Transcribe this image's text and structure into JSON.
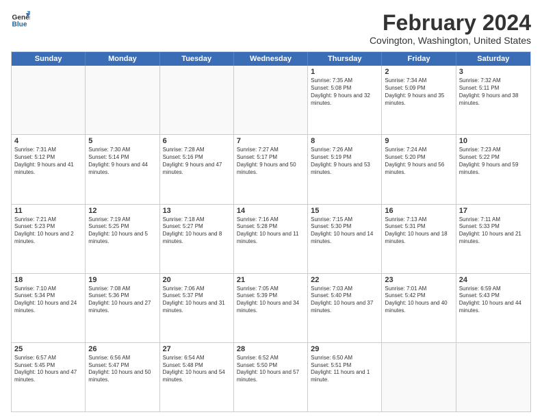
{
  "logo": {
    "line1": "General",
    "line2": "Blue"
  },
  "title": "February 2024",
  "subtitle": "Covington, Washington, United States",
  "days": [
    "Sunday",
    "Monday",
    "Tuesday",
    "Wednesday",
    "Thursday",
    "Friday",
    "Saturday"
  ],
  "weeks": [
    [
      {
        "day": "",
        "empty": true
      },
      {
        "day": "",
        "empty": true
      },
      {
        "day": "",
        "empty": true
      },
      {
        "day": "",
        "empty": true
      },
      {
        "day": "1",
        "sunrise": "Sunrise: 7:35 AM",
        "sunset": "Sunset: 5:08 PM",
        "daylight": "Daylight: 9 hours and 32 minutes."
      },
      {
        "day": "2",
        "sunrise": "Sunrise: 7:34 AM",
        "sunset": "Sunset: 5:09 PM",
        "daylight": "Daylight: 9 hours and 35 minutes."
      },
      {
        "day": "3",
        "sunrise": "Sunrise: 7:32 AM",
        "sunset": "Sunset: 5:11 PM",
        "daylight": "Daylight: 9 hours and 38 minutes."
      }
    ],
    [
      {
        "day": "4",
        "sunrise": "Sunrise: 7:31 AM",
        "sunset": "Sunset: 5:12 PM",
        "daylight": "Daylight: 9 hours and 41 minutes."
      },
      {
        "day": "5",
        "sunrise": "Sunrise: 7:30 AM",
        "sunset": "Sunset: 5:14 PM",
        "daylight": "Daylight: 9 hours and 44 minutes."
      },
      {
        "day": "6",
        "sunrise": "Sunrise: 7:28 AM",
        "sunset": "Sunset: 5:16 PM",
        "daylight": "Daylight: 9 hours and 47 minutes."
      },
      {
        "day": "7",
        "sunrise": "Sunrise: 7:27 AM",
        "sunset": "Sunset: 5:17 PM",
        "daylight": "Daylight: 9 hours and 50 minutes."
      },
      {
        "day": "8",
        "sunrise": "Sunrise: 7:26 AM",
        "sunset": "Sunset: 5:19 PM",
        "daylight": "Daylight: 9 hours and 53 minutes."
      },
      {
        "day": "9",
        "sunrise": "Sunrise: 7:24 AM",
        "sunset": "Sunset: 5:20 PM",
        "daylight": "Daylight: 9 hours and 56 minutes."
      },
      {
        "day": "10",
        "sunrise": "Sunrise: 7:23 AM",
        "sunset": "Sunset: 5:22 PM",
        "daylight": "Daylight: 9 hours and 59 minutes."
      }
    ],
    [
      {
        "day": "11",
        "sunrise": "Sunrise: 7:21 AM",
        "sunset": "Sunset: 5:23 PM",
        "daylight": "Daylight: 10 hours and 2 minutes."
      },
      {
        "day": "12",
        "sunrise": "Sunrise: 7:19 AM",
        "sunset": "Sunset: 5:25 PM",
        "daylight": "Daylight: 10 hours and 5 minutes."
      },
      {
        "day": "13",
        "sunrise": "Sunrise: 7:18 AM",
        "sunset": "Sunset: 5:27 PM",
        "daylight": "Daylight: 10 hours and 8 minutes."
      },
      {
        "day": "14",
        "sunrise": "Sunrise: 7:16 AM",
        "sunset": "Sunset: 5:28 PM",
        "daylight": "Daylight: 10 hours and 11 minutes."
      },
      {
        "day": "15",
        "sunrise": "Sunrise: 7:15 AM",
        "sunset": "Sunset: 5:30 PM",
        "daylight": "Daylight: 10 hours and 14 minutes."
      },
      {
        "day": "16",
        "sunrise": "Sunrise: 7:13 AM",
        "sunset": "Sunset: 5:31 PM",
        "daylight": "Daylight: 10 hours and 18 minutes."
      },
      {
        "day": "17",
        "sunrise": "Sunrise: 7:11 AM",
        "sunset": "Sunset: 5:33 PM",
        "daylight": "Daylight: 10 hours and 21 minutes."
      }
    ],
    [
      {
        "day": "18",
        "sunrise": "Sunrise: 7:10 AM",
        "sunset": "Sunset: 5:34 PM",
        "daylight": "Daylight: 10 hours and 24 minutes."
      },
      {
        "day": "19",
        "sunrise": "Sunrise: 7:08 AM",
        "sunset": "Sunset: 5:36 PM",
        "daylight": "Daylight: 10 hours and 27 minutes."
      },
      {
        "day": "20",
        "sunrise": "Sunrise: 7:06 AM",
        "sunset": "Sunset: 5:37 PM",
        "daylight": "Daylight: 10 hours and 31 minutes."
      },
      {
        "day": "21",
        "sunrise": "Sunrise: 7:05 AM",
        "sunset": "Sunset: 5:39 PM",
        "daylight": "Daylight: 10 hours and 34 minutes."
      },
      {
        "day": "22",
        "sunrise": "Sunrise: 7:03 AM",
        "sunset": "Sunset: 5:40 PM",
        "daylight": "Daylight: 10 hours and 37 minutes."
      },
      {
        "day": "23",
        "sunrise": "Sunrise: 7:01 AM",
        "sunset": "Sunset: 5:42 PM",
        "daylight": "Daylight: 10 hours and 40 minutes."
      },
      {
        "day": "24",
        "sunrise": "Sunrise: 6:59 AM",
        "sunset": "Sunset: 5:43 PM",
        "daylight": "Daylight: 10 hours and 44 minutes."
      }
    ],
    [
      {
        "day": "25",
        "sunrise": "Sunrise: 6:57 AM",
        "sunset": "Sunset: 5:45 PM",
        "daylight": "Daylight: 10 hours and 47 minutes."
      },
      {
        "day": "26",
        "sunrise": "Sunrise: 6:56 AM",
        "sunset": "Sunset: 5:47 PM",
        "daylight": "Daylight: 10 hours and 50 minutes."
      },
      {
        "day": "27",
        "sunrise": "Sunrise: 6:54 AM",
        "sunset": "Sunset: 5:48 PM",
        "daylight": "Daylight: 10 hours and 54 minutes."
      },
      {
        "day": "28",
        "sunrise": "Sunrise: 6:52 AM",
        "sunset": "Sunset: 5:50 PM",
        "daylight": "Daylight: 10 hours and 57 minutes."
      },
      {
        "day": "29",
        "sunrise": "Sunrise: 6:50 AM",
        "sunset": "Sunset: 5:51 PM",
        "daylight": "Daylight: 11 hours and 1 minute."
      },
      {
        "day": "",
        "empty": true
      },
      {
        "day": "",
        "empty": true
      }
    ]
  ]
}
